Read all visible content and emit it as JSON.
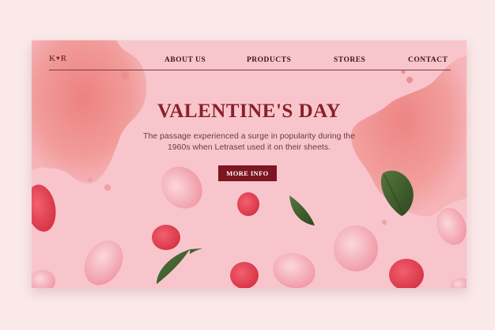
{
  "logo": {
    "left": "K",
    "heart": "♥",
    "right": "R"
  },
  "nav": {
    "items": [
      "ABOUT US",
      "PRODUCTS",
      "STORES",
      "CONTACT"
    ]
  },
  "hero": {
    "title": "VALENTINE'S DAY",
    "body": "The passage experienced a surge in popularity during the 1960s when Letraset used it on their sheets.",
    "cta": "MORE INFO"
  },
  "colors": {
    "background": "#f8c5cd",
    "page": "#fbe9e9",
    "title": "#8a1f29",
    "button": "#7c1620",
    "petal": "#e8455a",
    "leaf": "#3f5a2c"
  }
}
